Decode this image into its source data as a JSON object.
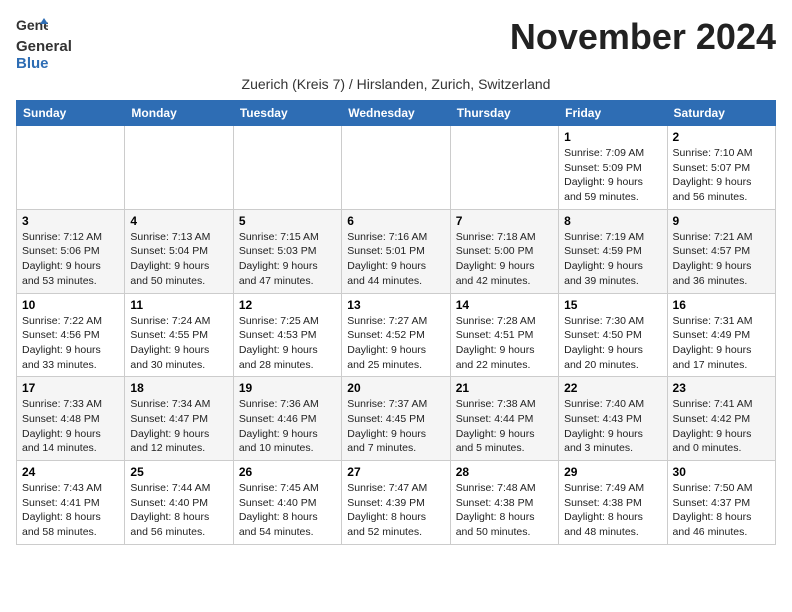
{
  "app": {
    "logo_line1": "General",
    "logo_line2": "Blue"
  },
  "header": {
    "month_year": "November 2024",
    "subtitle": "Zuerich (Kreis 7) / Hirslanden, Zurich, Switzerland"
  },
  "weekdays": [
    "Sunday",
    "Monday",
    "Tuesday",
    "Wednesday",
    "Thursday",
    "Friday",
    "Saturday"
  ],
  "weeks": [
    [
      {
        "day": "",
        "info": ""
      },
      {
        "day": "",
        "info": ""
      },
      {
        "day": "",
        "info": ""
      },
      {
        "day": "",
        "info": ""
      },
      {
        "day": "",
        "info": ""
      },
      {
        "day": "1",
        "info": "Sunrise: 7:09 AM\nSunset: 5:09 PM\nDaylight: 9 hours and 59 minutes."
      },
      {
        "day": "2",
        "info": "Sunrise: 7:10 AM\nSunset: 5:07 PM\nDaylight: 9 hours and 56 minutes."
      }
    ],
    [
      {
        "day": "3",
        "info": "Sunrise: 7:12 AM\nSunset: 5:06 PM\nDaylight: 9 hours and 53 minutes."
      },
      {
        "day": "4",
        "info": "Sunrise: 7:13 AM\nSunset: 5:04 PM\nDaylight: 9 hours and 50 minutes."
      },
      {
        "day": "5",
        "info": "Sunrise: 7:15 AM\nSunset: 5:03 PM\nDaylight: 9 hours and 47 minutes."
      },
      {
        "day": "6",
        "info": "Sunrise: 7:16 AM\nSunset: 5:01 PM\nDaylight: 9 hours and 44 minutes."
      },
      {
        "day": "7",
        "info": "Sunrise: 7:18 AM\nSunset: 5:00 PM\nDaylight: 9 hours and 42 minutes."
      },
      {
        "day": "8",
        "info": "Sunrise: 7:19 AM\nSunset: 4:59 PM\nDaylight: 9 hours and 39 minutes."
      },
      {
        "day": "9",
        "info": "Sunrise: 7:21 AM\nSunset: 4:57 PM\nDaylight: 9 hours and 36 minutes."
      }
    ],
    [
      {
        "day": "10",
        "info": "Sunrise: 7:22 AM\nSunset: 4:56 PM\nDaylight: 9 hours and 33 minutes."
      },
      {
        "day": "11",
        "info": "Sunrise: 7:24 AM\nSunset: 4:55 PM\nDaylight: 9 hours and 30 minutes."
      },
      {
        "day": "12",
        "info": "Sunrise: 7:25 AM\nSunset: 4:53 PM\nDaylight: 9 hours and 28 minutes."
      },
      {
        "day": "13",
        "info": "Sunrise: 7:27 AM\nSunset: 4:52 PM\nDaylight: 9 hours and 25 minutes."
      },
      {
        "day": "14",
        "info": "Sunrise: 7:28 AM\nSunset: 4:51 PM\nDaylight: 9 hours and 22 minutes."
      },
      {
        "day": "15",
        "info": "Sunrise: 7:30 AM\nSunset: 4:50 PM\nDaylight: 9 hours and 20 minutes."
      },
      {
        "day": "16",
        "info": "Sunrise: 7:31 AM\nSunset: 4:49 PM\nDaylight: 9 hours and 17 minutes."
      }
    ],
    [
      {
        "day": "17",
        "info": "Sunrise: 7:33 AM\nSunset: 4:48 PM\nDaylight: 9 hours and 14 minutes."
      },
      {
        "day": "18",
        "info": "Sunrise: 7:34 AM\nSunset: 4:47 PM\nDaylight: 9 hours and 12 minutes."
      },
      {
        "day": "19",
        "info": "Sunrise: 7:36 AM\nSunset: 4:46 PM\nDaylight: 9 hours and 10 minutes."
      },
      {
        "day": "20",
        "info": "Sunrise: 7:37 AM\nSunset: 4:45 PM\nDaylight: 9 hours and 7 minutes."
      },
      {
        "day": "21",
        "info": "Sunrise: 7:38 AM\nSunset: 4:44 PM\nDaylight: 9 hours and 5 minutes."
      },
      {
        "day": "22",
        "info": "Sunrise: 7:40 AM\nSunset: 4:43 PM\nDaylight: 9 hours and 3 minutes."
      },
      {
        "day": "23",
        "info": "Sunrise: 7:41 AM\nSunset: 4:42 PM\nDaylight: 9 hours and 0 minutes."
      }
    ],
    [
      {
        "day": "24",
        "info": "Sunrise: 7:43 AM\nSunset: 4:41 PM\nDaylight: 8 hours and 58 minutes."
      },
      {
        "day": "25",
        "info": "Sunrise: 7:44 AM\nSunset: 4:40 PM\nDaylight: 8 hours and 56 minutes."
      },
      {
        "day": "26",
        "info": "Sunrise: 7:45 AM\nSunset: 4:40 PM\nDaylight: 8 hours and 54 minutes."
      },
      {
        "day": "27",
        "info": "Sunrise: 7:47 AM\nSunset: 4:39 PM\nDaylight: 8 hours and 52 minutes."
      },
      {
        "day": "28",
        "info": "Sunrise: 7:48 AM\nSunset: 4:38 PM\nDaylight: 8 hours and 50 minutes."
      },
      {
        "day": "29",
        "info": "Sunrise: 7:49 AM\nSunset: 4:38 PM\nDaylight: 8 hours and 48 minutes."
      },
      {
        "day": "30",
        "info": "Sunrise: 7:50 AM\nSunset: 4:37 PM\nDaylight: 8 hours and 46 minutes."
      }
    ]
  ]
}
